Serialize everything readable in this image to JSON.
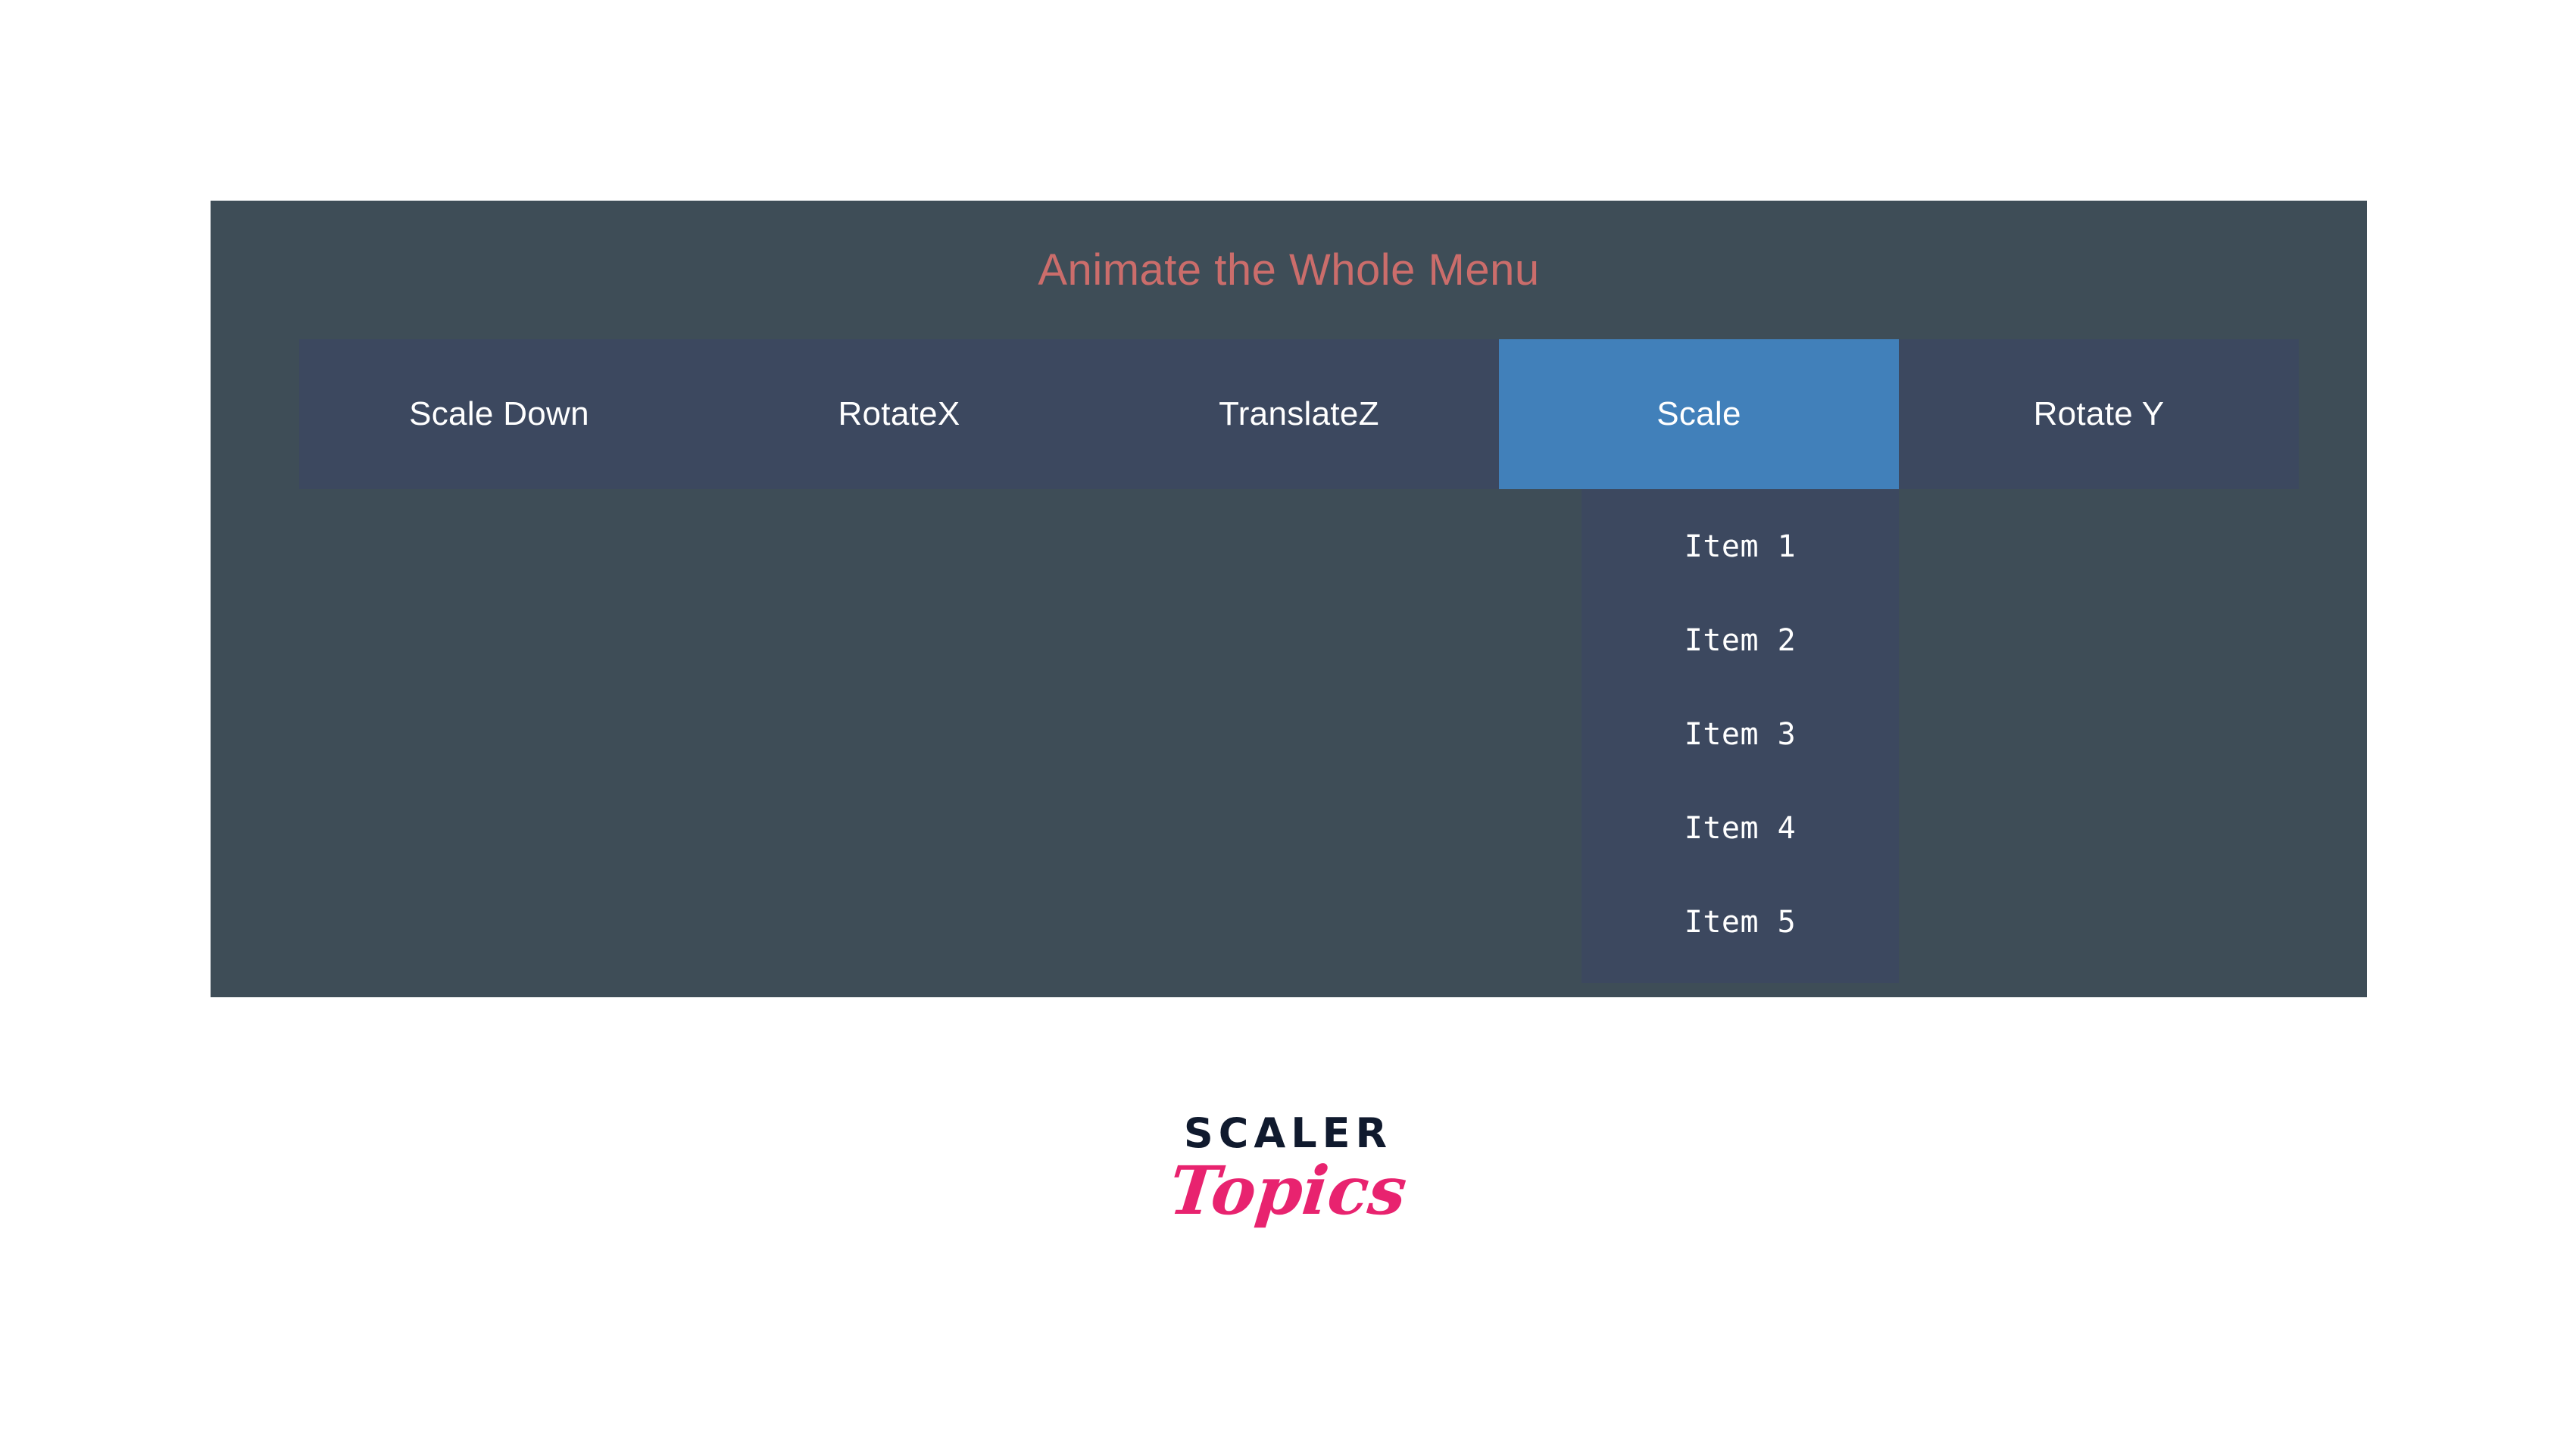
{
  "stage": {
    "title": "Animate the Whole Menu",
    "background_color": "#3e4d57",
    "title_color": "#cb6d6b"
  },
  "menu": {
    "background_color": "#3c485f",
    "active_color": "#4180ba",
    "text_color": "#ffffff",
    "tabs": [
      {
        "label": "Scale Down",
        "active": false
      },
      {
        "label": "RotateX",
        "active": false
      },
      {
        "label": "TranslateZ",
        "active": false
      },
      {
        "label": "Scale",
        "active": true
      },
      {
        "label": "Rotate Y",
        "active": false
      }
    ]
  },
  "dropdown": {
    "owner_tab": "Scale",
    "background_color": "#3c485f",
    "items": [
      {
        "label": "Item 1"
      },
      {
        "label": "Item 2"
      },
      {
        "label": "Item 3"
      },
      {
        "label": "Item 4"
      },
      {
        "label": "Item 5"
      }
    ]
  },
  "brand": {
    "primary": "SCALER",
    "secondary": "Topics",
    "primary_color": "#101a2e",
    "secondary_color": "#e8236f"
  }
}
